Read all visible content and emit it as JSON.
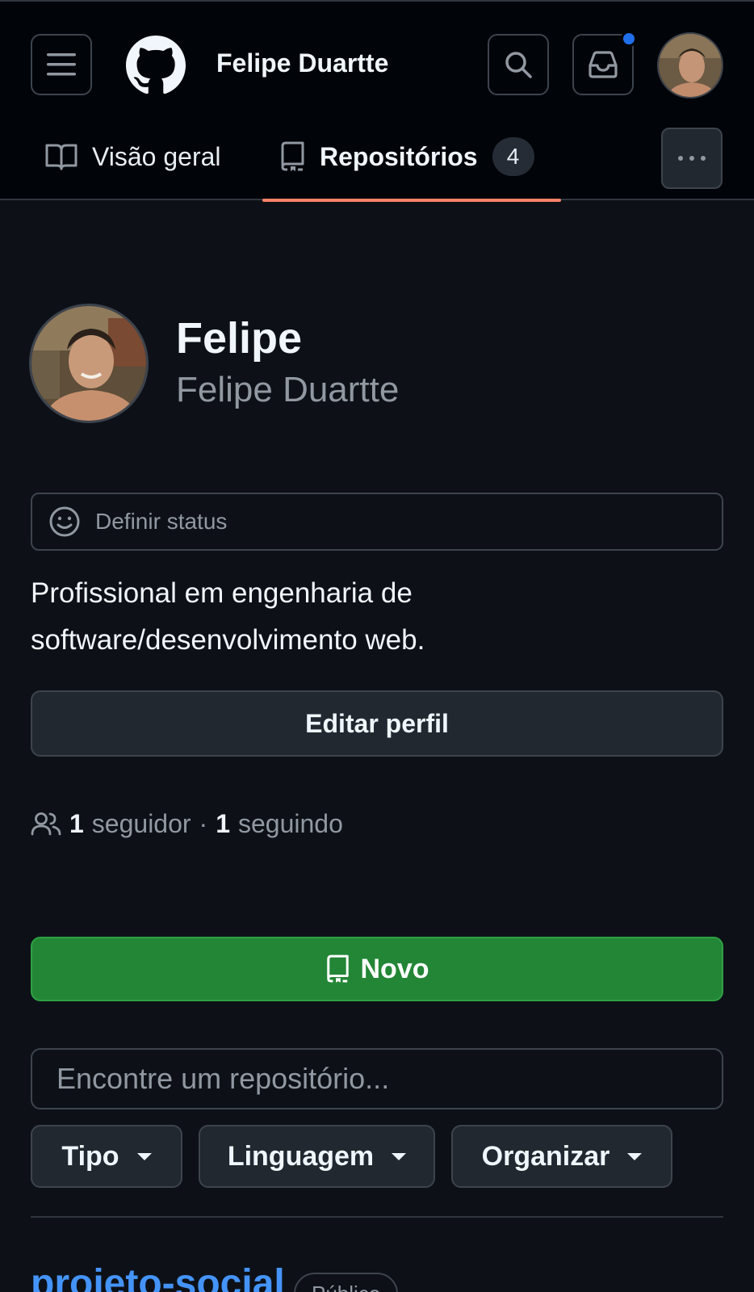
{
  "header": {
    "username": "Felipe Duartte"
  },
  "tabs": [
    {
      "label": "Visão geral"
    },
    {
      "label": "Repositórios",
      "count": "4"
    }
  ],
  "profile": {
    "name": "Felipe",
    "login": "Felipe Duartte",
    "status_placeholder": "Definir status",
    "bio_line1": "Profissional em engenharia de",
    "bio_line2": "software/desenvolvimento web.",
    "edit_label": "Editar perfil",
    "followers_count": "1",
    "followers_label": "seguidor",
    "separator": "·",
    "following_count": "1",
    "following_label": "seguindo"
  },
  "repos": {
    "new_label": "Novo",
    "search_placeholder": "Encontre um repositório...",
    "filters": [
      {
        "label": "Tipo"
      },
      {
        "label": "Linguagem"
      },
      {
        "label": "Organizar"
      }
    ],
    "first_repo_name": "projeto-social",
    "first_repo_badge": "Público"
  },
  "colors": {
    "accent_underline": "#f78166",
    "new_button": "#238636",
    "link": "#4493f8",
    "notification_dot": "#1f6feb"
  },
  "icons": [
    "menu-icon",
    "github-logo-icon",
    "search-icon",
    "inbox-icon",
    "book-icon",
    "repo-icon",
    "kebab-icon",
    "smiley-icon",
    "people-icon",
    "caret-down-icon"
  ]
}
